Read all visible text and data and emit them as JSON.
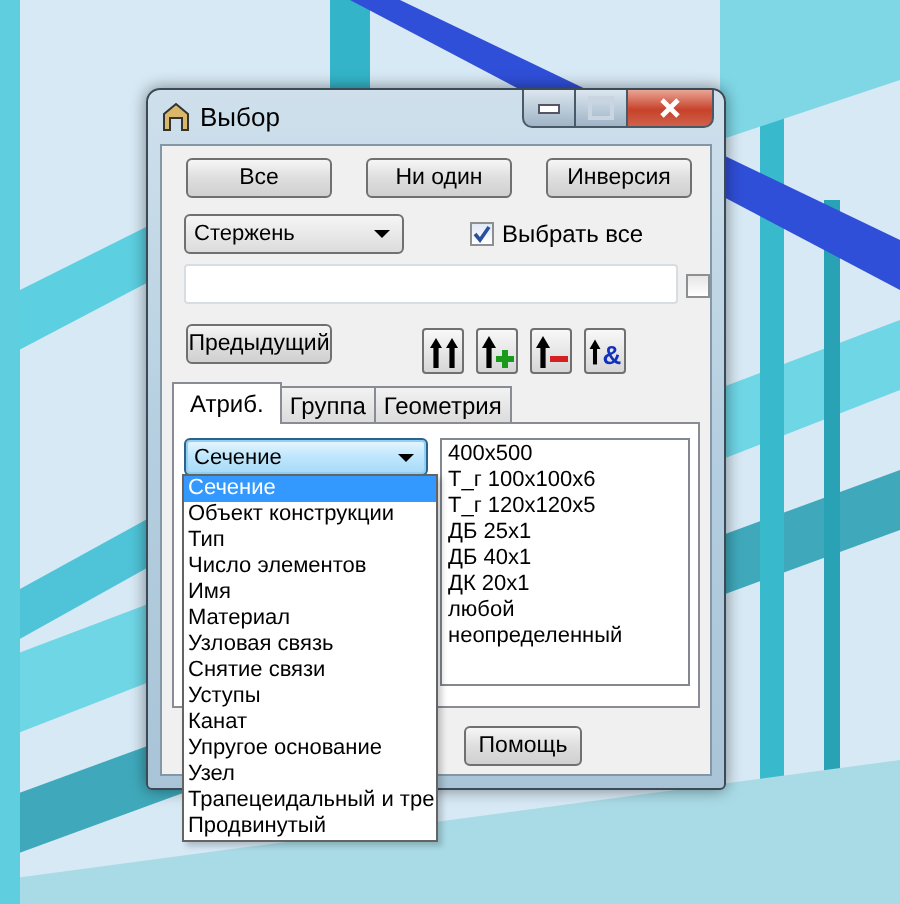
{
  "window": {
    "title": "Выбор"
  },
  "top_buttons": [
    "Все",
    "Ни один",
    "Инверсия"
  ],
  "element_type": {
    "value": "Стержень"
  },
  "select_all": {
    "label": "Выбрать все",
    "checked": true
  },
  "filter": {
    "checked": false
  },
  "previous_button": "Предыдущий",
  "toolbar": [
    {
      "kind": "replace"
    },
    {
      "kind": "add"
    },
    {
      "kind": "subtract"
    },
    {
      "kind": "intersect",
      "glyph": "&"
    }
  ],
  "tabs": [
    {
      "label": "Атриб.",
      "selected": true
    },
    {
      "label": "Группа",
      "selected": false
    },
    {
      "label": "Геометрия",
      "selected": false
    }
  ],
  "attribute": {
    "value": "Сечение",
    "expanded": true,
    "options": [
      {
        "label": "Сечение",
        "selected": true
      },
      {
        "label": "Объект конструкции",
        "selected": false
      },
      {
        "label": "Тип",
        "selected": false
      },
      {
        "label": "Число элементов",
        "selected": false
      },
      {
        "label": "Имя",
        "selected": false
      },
      {
        "label": "Материал",
        "selected": false
      },
      {
        "label": "Узловая связь",
        "selected": false
      },
      {
        "label": "Снятие связи",
        "selected": false
      },
      {
        "label": "Уступы",
        "selected": false
      },
      {
        "label": "Канат",
        "selected": false
      },
      {
        "label": "Упругое основание",
        "selected": false
      },
      {
        "label": "Узел",
        "selected": false
      },
      {
        "label": "Трапецеидальный и тре",
        "selected": false
      },
      {
        "label": "Продвинутый",
        "selected": false
      }
    ]
  },
  "values": [
    "400x500",
    "T_г 100x100x6",
    "T_г 120x120x5",
    "ДБ 25x1",
    "ДБ 40x1",
    "ДК 20x1",
    "любой",
    "неопределенный"
  ],
  "buttons": [
    "Помощь"
  ]
}
